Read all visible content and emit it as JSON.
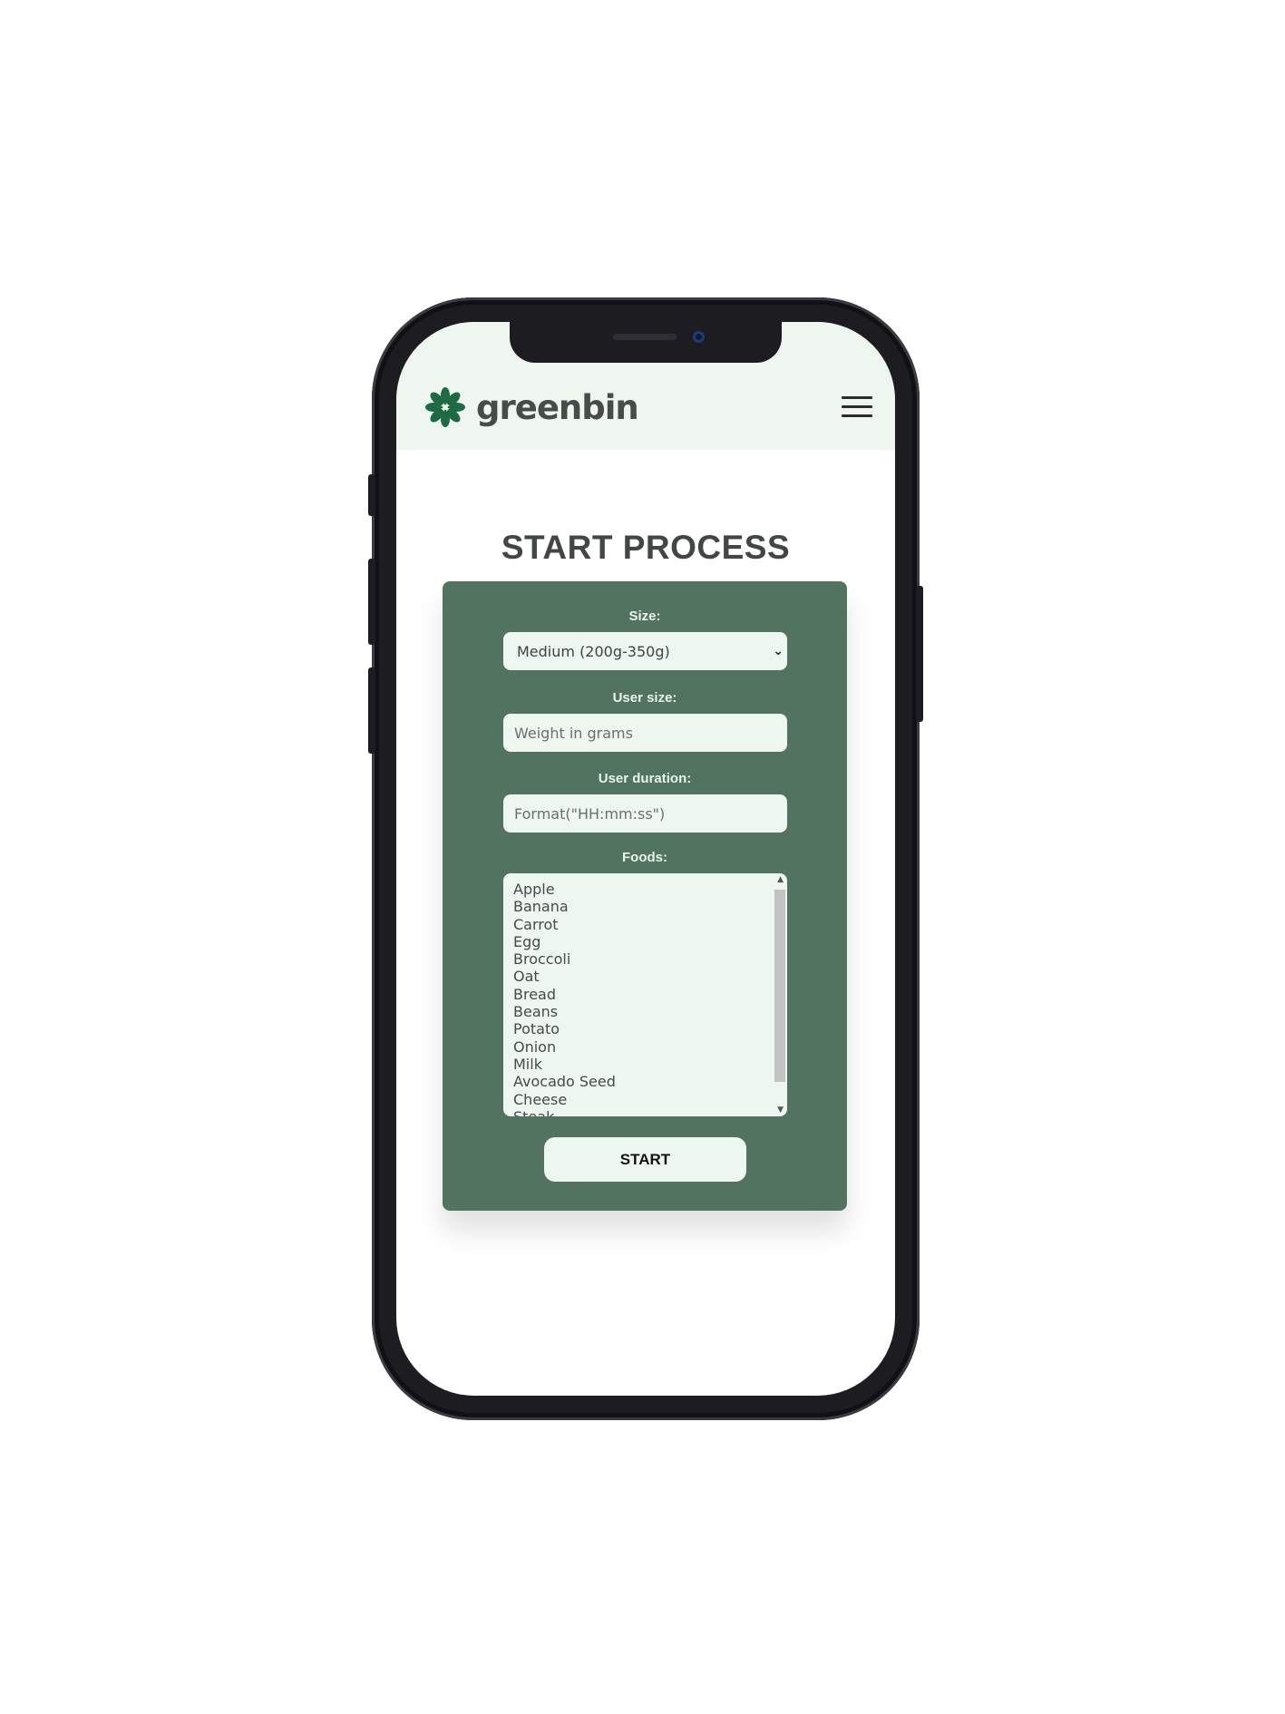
{
  "header": {
    "brand": "greenbin",
    "logo_icon": "flower-logo-icon",
    "menu_icon": "hamburger-menu-icon",
    "background": "#eff6f0"
  },
  "page": {
    "title": "START PROCESS"
  },
  "form": {
    "card_color": "#52735f",
    "size_label": "Size:",
    "size_value": "Medium (200g-350g)",
    "user_size_label": "User size:",
    "user_size_placeholder": "Weight in grams",
    "user_duration_label": "User duration:",
    "user_duration_placeholder": "Format(\"HH:mm:ss\")",
    "foods_label": "Foods:",
    "foods": [
      "Apple",
      "Banana",
      "Carrot",
      "Egg",
      "Broccoli",
      "Oat",
      "Bread",
      "Beans",
      "Potato",
      "Onion",
      "Milk",
      "Avocado Seed",
      "Cheese",
      "Steak"
    ],
    "start_label": "START"
  }
}
